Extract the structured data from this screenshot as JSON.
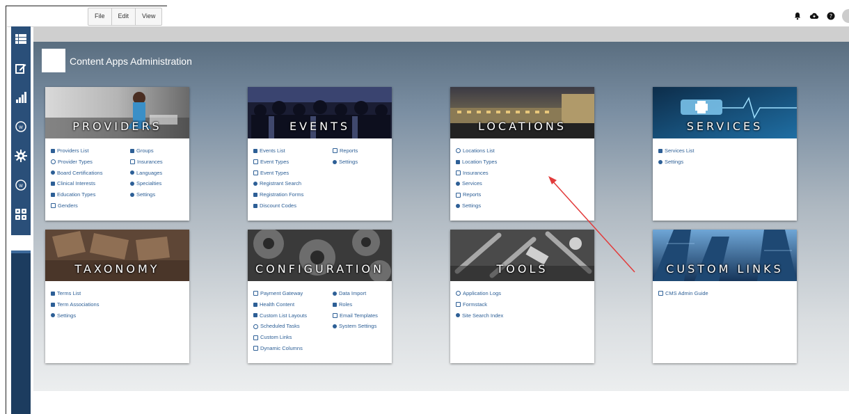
{
  "menubar": {
    "items": [
      "File",
      "Edit",
      "View"
    ]
  },
  "top_icons": [
    "bell-icon",
    "cloud-icon",
    "help-icon"
  ],
  "sidebar": {
    "icons": [
      "list-icon",
      "edit-icon",
      "bar-chart-icon",
      "wordpress-icon",
      "gear-icon",
      "wordpress-icon",
      "apps-icon"
    ]
  },
  "page": {
    "title": "Content Apps Administration"
  },
  "cards": [
    {
      "title": "PROVIDERS",
      "col1": [
        "Providers List",
        "Provider Types",
        "Board Certifications",
        "Clinical Interests",
        "Education Types",
        "Genders"
      ],
      "col2": [
        "Groups",
        "Insurances",
        "Languages",
        "Specialties",
        "Settings"
      ]
    },
    {
      "title": "EVENTS",
      "col1": [
        "Events List",
        "Event Types",
        "Event Types",
        "Registrant Search",
        "Registration Forms",
        "Discount Codes"
      ],
      "col2": [
        "Reports",
        "Settings"
      ]
    },
    {
      "title": "LOCATIONS",
      "col1": [
        "Locations List",
        "Location Types",
        "Insurances",
        "Services",
        "Reports",
        "Settings"
      ],
      "col2": []
    },
    {
      "title": "SERVICES",
      "col1": [
        "Services List",
        "Settings"
      ],
      "col2": []
    },
    {
      "title": "TAXONOMY",
      "col1": [
        "Terms List",
        "Term Associations",
        "Settings"
      ],
      "col2": []
    },
    {
      "title": "CONFIGURATION",
      "col1": [
        "Payment Gateway",
        "Health Content",
        "Custom List Layouts",
        "Scheduled Tasks",
        "Custom Links",
        "Dynamic Columns"
      ],
      "col2": [
        "Data Import",
        "Roles",
        "Email Templates",
        "System Settings"
      ]
    },
    {
      "title": "TOOLS",
      "col1": [
        "Application Logs",
        "Formstack",
        "Site Search Index"
      ],
      "col2": []
    },
    {
      "title": "CUSTOM LINKS",
      "col1": [
        "CMS Admin Guide"
      ],
      "col2": []
    }
  ],
  "colors": {
    "sidebar": "#1c3c5f",
    "link": "#2d5f96",
    "arrow": "#e23b3b"
  }
}
